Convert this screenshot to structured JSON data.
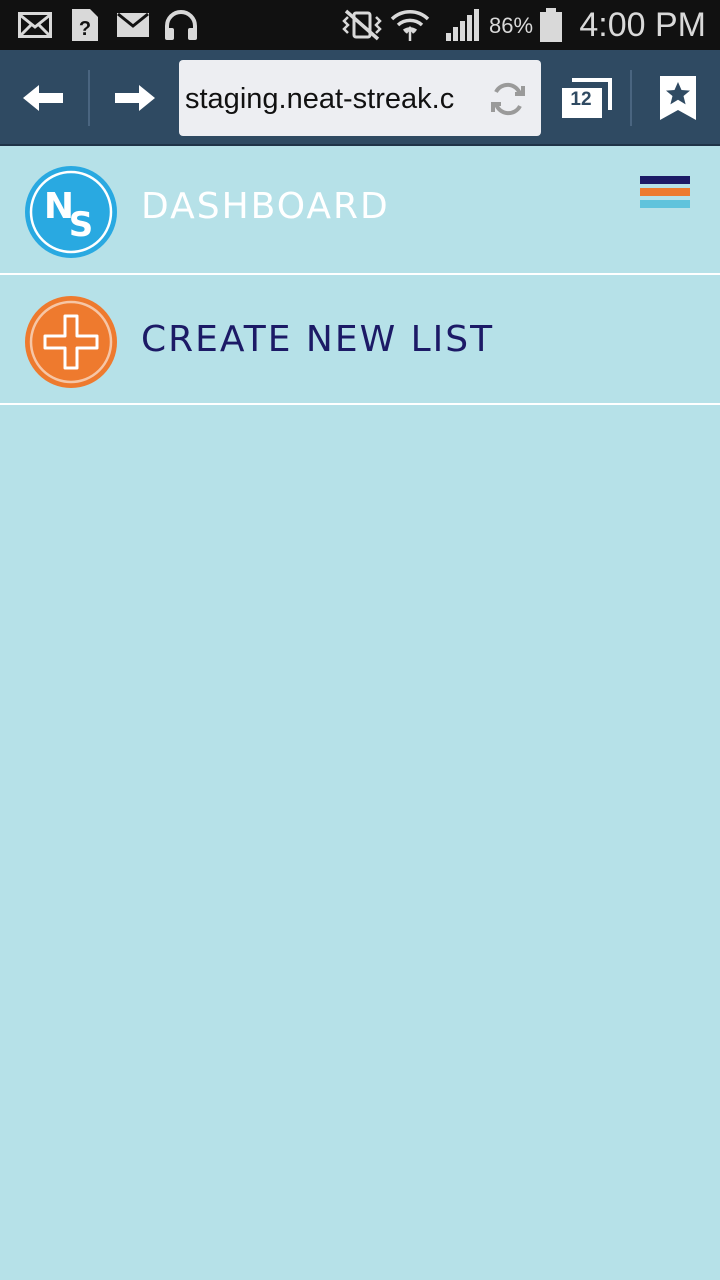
{
  "status_bar": {
    "icons": [
      "email-icon",
      "unknown-file-icon",
      "gmail-icon",
      "headphones-icon",
      "vibrate-mute-icon",
      "wifi-icon",
      "signal-icon",
      "battery-icon"
    ],
    "battery_percent": "86%",
    "time": "4:00 PM"
  },
  "browser": {
    "url": "staging.neat-streak.c",
    "tab_count": "12"
  },
  "menu": {
    "items": [
      {
        "label": "DASHBOARD",
        "icon": "neat-streak-logo-icon",
        "color": "#ffffff"
      },
      {
        "label": "CREATE NEW LIST",
        "icon": "add-circle-icon",
        "color": "#1c1a66"
      }
    ],
    "hamburger_colors": [
      "#1c1a66",
      "#ee7a2e",
      "#5fc3dc"
    ]
  },
  "colors": {
    "background": "#b6e1e8",
    "toolbar": "#2f4a62",
    "status_bar": "#111111",
    "brand_blue": "#29a9e1",
    "brand_orange": "#ee7a2e"
  }
}
